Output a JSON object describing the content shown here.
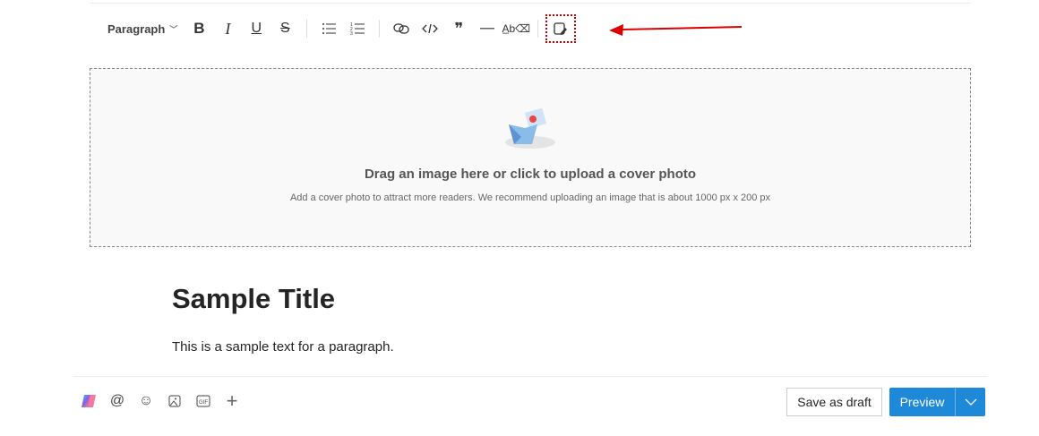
{
  "toolbar": {
    "paragraph_label": "Paragraph",
    "chevron": "⌵",
    "bold": "B",
    "italic": "I",
    "underline": "U",
    "strike": "S",
    "numbered_marker": "1 2 3"
  },
  "cover": {
    "heading": "Drag an image here or click to upload a cover photo",
    "hint": "Add a cover photo to attract more readers. We recommend uploading an image that is about 1000 px x 200 px"
  },
  "article": {
    "title": "Sample Title",
    "paragraph": "This is a sample text for a paragraph."
  },
  "footer": {
    "gif_label": "GIF",
    "save_draft": "Save as draft",
    "preview": "Preview"
  },
  "colors": {
    "accent": "#1e88d9",
    "annotation": "#dd0000"
  }
}
